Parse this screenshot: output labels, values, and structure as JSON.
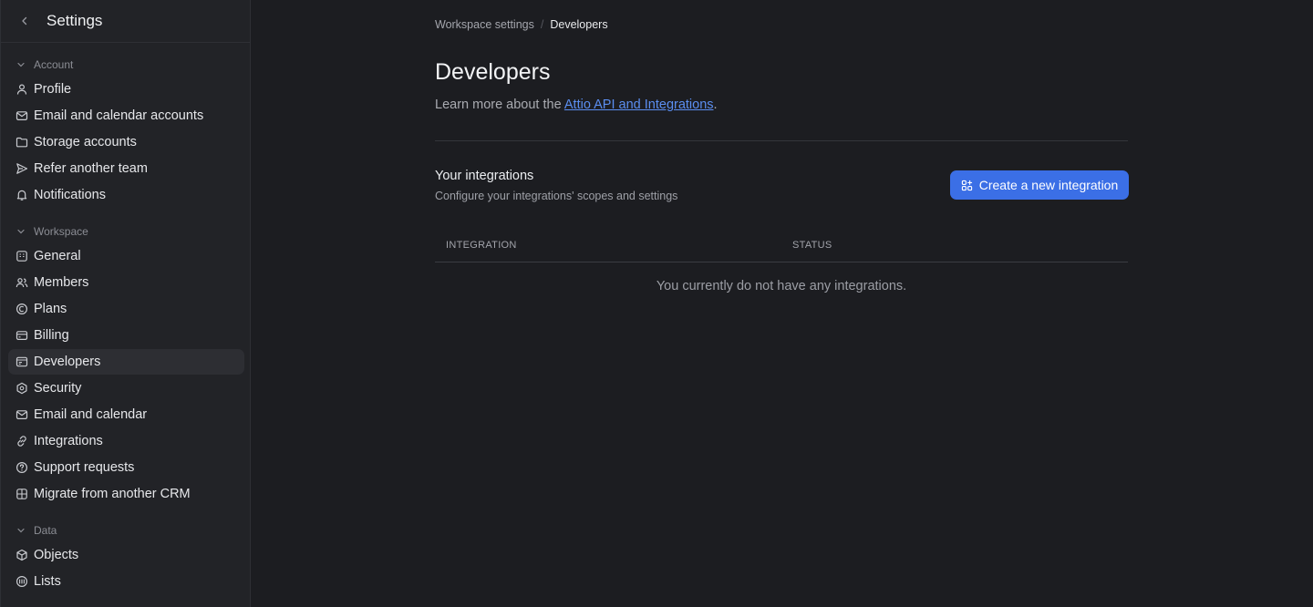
{
  "sidebar": {
    "title": "Settings",
    "groups": {
      "account": {
        "label": "Account",
        "items": [
          "Profile",
          "Email and calendar accounts",
          "Storage accounts",
          "Refer another team",
          "Notifications"
        ]
      },
      "workspace": {
        "label": "Workspace",
        "items": [
          "General",
          "Members",
          "Plans",
          "Billing",
          "Developers",
          "Security",
          "Email and calendar",
          "Integrations",
          "Support requests",
          "Migrate from another CRM"
        ]
      },
      "data": {
        "label": "Data",
        "items": [
          "Objects",
          "Lists"
        ]
      }
    },
    "active_item": "Developers"
  },
  "breadcrumb": {
    "parent": "Workspace settings",
    "separator": "/",
    "current": "Developers"
  },
  "page": {
    "title": "Developers",
    "subtitle_prefix": "Learn more about the ",
    "subtitle_link": "Attio API and Integrations",
    "subtitle_suffix": "."
  },
  "integrations": {
    "title": "Your integrations",
    "description": "Configure your integrations' scopes and settings",
    "create_button": "Create a new integration",
    "columns": [
      "INTEGRATION",
      "STATUS"
    ],
    "empty_message": "You currently do not have any integrations."
  },
  "colors": {
    "background": "#1c1d21",
    "sidebar": "#222327",
    "accent": "#3b6fe6",
    "link": "#5b8ef0"
  }
}
